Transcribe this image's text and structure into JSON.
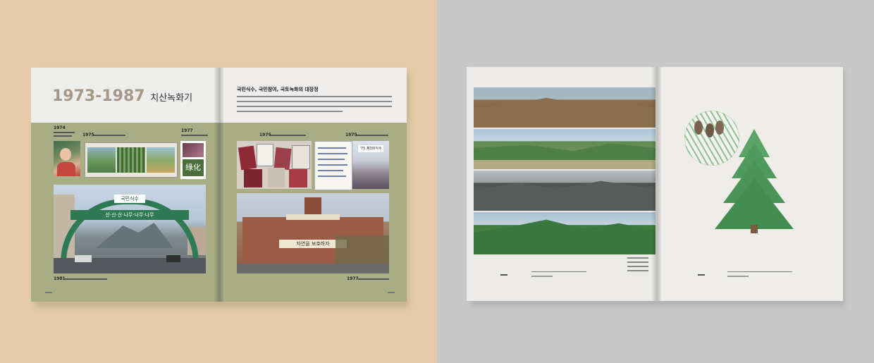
{
  "left_spread": {
    "title_years": "1973-1987",
    "title_name": "치산녹화기",
    "heading": "국민식수, 국민참여, 국토녹화의 대장정",
    "year_labels": [
      "1974",
      "1975",
      "1977",
      "1975",
      "1975",
      "1981",
      "1977"
    ],
    "photo_signs": {
      "arch_top": "국민식수",
      "arch_main": "산·산·산·나무·나무·나무",
      "bar_building": "자연을 보호하자",
      "stamp": "綠化",
      "poster_tag": "'75 제3회식수"
    },
    "colors": {
      "background": "#e4cba7",
      "band": "#a8ad86",
      "page": "#ededeb"
    }
  },
  "right_spread": {
    "colors": {
      "background": "#c8c8c8",
      "page": "#ecebe8",
      "tree": "#4f9a5d"
    }
  }
}
